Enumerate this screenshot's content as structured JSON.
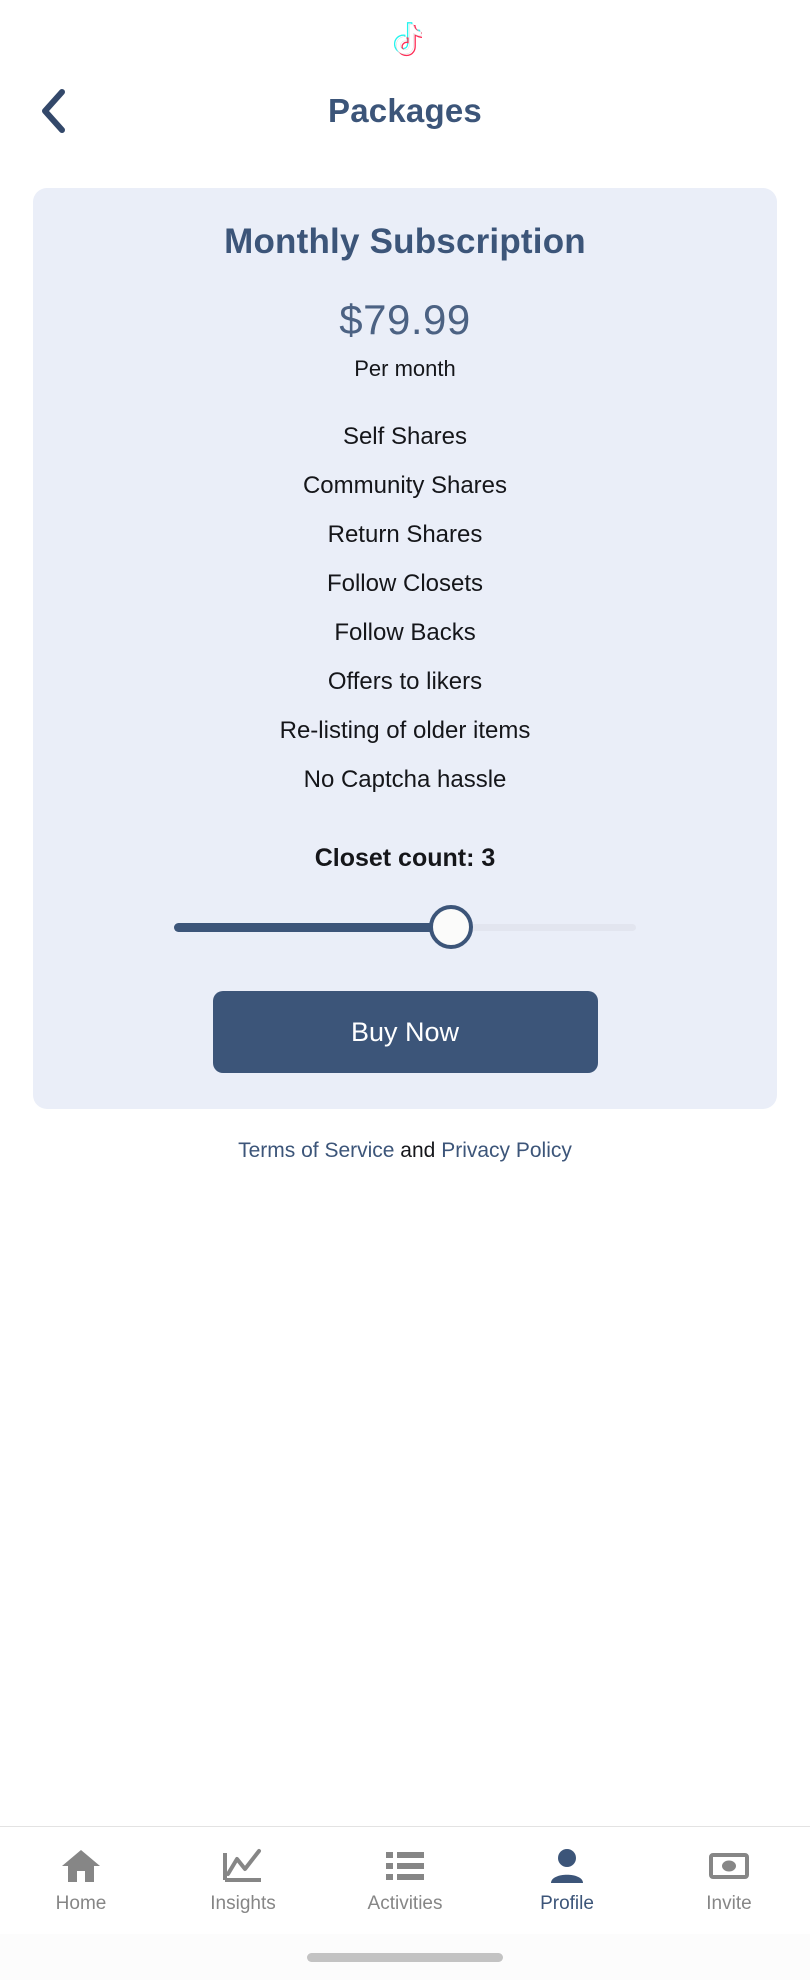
{
  "brand": {
    "logo_icon": "tiktok-logo-icon",
    "logo_colors": {
      "cyan": "#25f4ee",
      "pink": "#fe2c55",
      "dark": "#ffffff"
    }
  },
  "header": {
    "back_icon": "chevron-left-icon",
    "title": "Packages"
  },
  "theme": {
    "accent": "#3c5579",
    "card_bg": "#eaeef8",
    "text": "#15161a",
    "muted": "#868686",
    "track": "#e2e5ef"
  },
  "package_card": {
    "title": "Monthly Subscription",
    "price": "$79.99",
    "price_period": "Per month",
    "features": [
      "Self Shares",
      "Community Shares",
      "Return Shares",
      "Follow Closets",
      "Follow Backs",
      "Offers to likers",
      "Re-listing of older items",
      "No Captcha hassle"
    ],
    "closet_count_label": "Closet count: 3",
    "slider": {
      "value": 3,
      "min": 1,
      "max": 5,
      "percent": 60
    },
    "buy_label": "Buy Now"
  },
  "legal": {
    "terms_label": "Terms of Service",
    "conjunction": " and ",
    "privacy_label": "Privacy Policy"
  },
  "bottom_nav": {
    "items": [
      {
        "label": "Home",
        "icon": "home-icon",
        "active": false
      },
      {
        "label": "Insights",
        "icon": "chart-line-icon",
        "active": false
      },
      {
        "label": "Activities",
        "icon": "list-icon",
        "active": false
      },
      {
        "label": "Profile",
        "icon": "person-icon",
        "active": true
      },
      {
        "label": "Invite",
        "icon": "money-card-icon",
        "active": false
      }
    ]
  }
}
